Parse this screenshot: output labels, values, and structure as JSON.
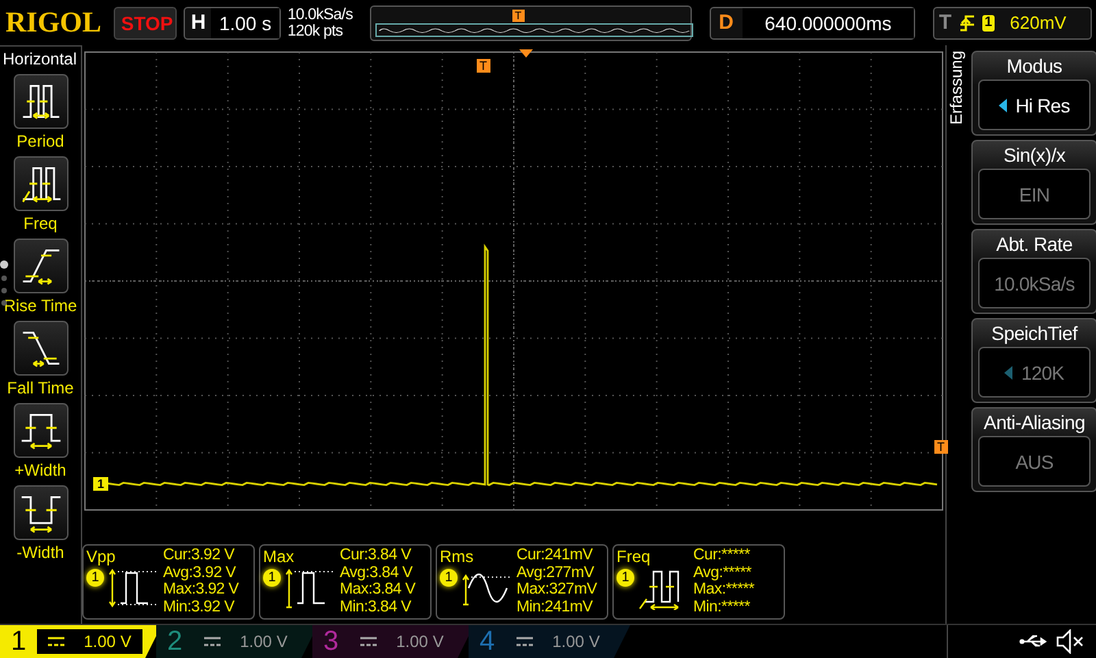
{
  "top_bar": {
    "logo": "RIGOL",
    "run_state": "STOP",
    "horizontal": {
      "label": "H",
      "value": "1.00 s"
    },
    "sample_rate": "10.0kSa/s",
    "memory_depth": "120k pts",
    "overview_trigger": "T",
    "delay": {
      "label": "D",
      "value": "640.000000ms"
    },
    "trigger": {
      "label": "T",
      "channel": "1",
      "level": "620mV"
    }
  },
  "left_menu": {
    "title": "Horizontal",
    "items": [
      {
        "kind": "period",
        "label": "Period"
      },
      {
        "kind": "freq",
        "label": "Freq"
      },
      {
        "kind": "rise",
        "label": "Rise Time"
      },
      {
        "kind": "fall",
        "label": "Fall Time"
      },
      {
        "kind": "pwidth",
        "label": "+Width"
      },
      {
        "kind": "nwidth",
        "label": "-Width"
      }
    ],
    "pages": [
      {
        "selected": true
      },
      {
        "selected": false
      },
      {
        "selected": false
      },
      {
        "selected": false
      }
    ]
  },
  "scope": {
    "trigger_marker": "T",
    "trigger_level_marker": "T",
    "channel_marker": "1"
  },
  "right_menu": {
    "title": "Erfassung",
    "items": [
      {
        "title": "Modus",
        "value": "Hi Res",
        "enabled": true,
        "kind": "select"
      },
      {
        "title": "Sin(x)/x",
        "value": "EIN",
        "enabled": false,
        "kind": "plain"
      },
      {
        "title": "Abt. Rate",
        "value": "10.0kSa/s",
        "enabled": false,
        "kind": "plain"
      },
      {
        "title": "SpeichTief",
        "value": "120K",
        "enabled": false,
        "kind": "select"
      },
      {
        "title": "Anti-Aliasing",
        "value": "AUS",
        "enabled": false,
        "kind": "plain"
      }
    ]
  },
  "measurements": [
    {
      "kind": "vpp",
      "name": "Vpp",
      "channel": "1",
      "stats": [
        "Cur:3.92 V",
        "Avg:3.92 V",
        "Max:3.92 V",
        "Min:3.92 V"
      ]
    },
    {
      "kind": "max",
      "name": "Max",
      "channel": "1",
      "stats": [
        "Cur:3.84 V",
        "Avg:3.84 V",
        "Max:3.84 V",
        "Min:3.84 V"
      ]
    },
    {
      "kind": "rms",
      "name": "Rms",
      "channel": "1",
      "stats": [
        "Cur:241mV",
        "Avg:277mV",
        "Max:327mV",
        "Min:241mV"
      ]
    },
    {
      "kind": "freq",
      "name": "Freq",
      "channel": "1",
      "stats": [
        "Cur:*****",
        "Avg:*****",
        "Max:*****",
        "Min:*****"
      ]
    }
  ],
  "channels": [
    {
      "number": "1",
      "scale": "1.00 V",
      "selected": true,
      "color": "#f5ea00"
    },
    {
      "number": "2",
      "scale": "1.00 V",
      "selected": false,
      "color": "#1e8c7c"
    },
    {
      "number": "3",
      "scale": "1.00 V",
      "selected": false,
      "color": "#b02a9c"
    },
    {
      "number": "4",
      "scale": "1.00 V",
      "selected": false,
      "color": "#1d6fb0"
    }
  ]
}
